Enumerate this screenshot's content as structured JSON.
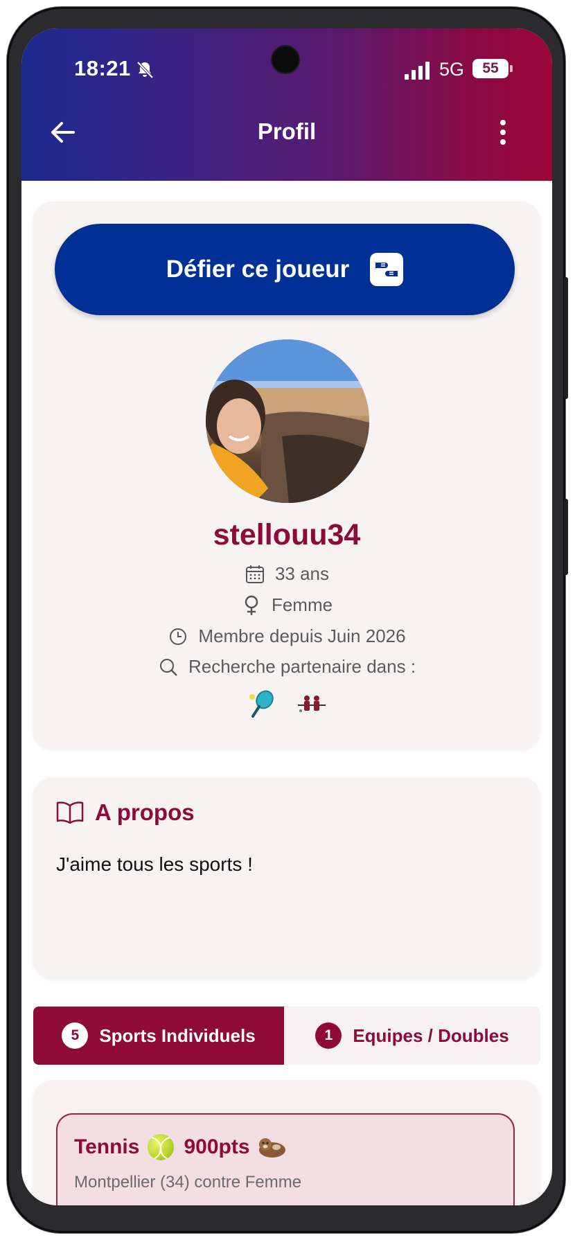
{
  "status_bar": {
    "time": "18:21",
    "network": "5G",
    "battery": "55"
  },
  "header": {
    "title": "Profil"
  },
  "profile": {
    "challenge_label": "Défier ce joueur",
    "username": "stellouu34",
    "age": "33 ans",
    "gender": "Femme",
    "member_since": "Membre depuis Juin 2026",
    "looking_for": "Recherche partenaire dans :",
    "sport_icons": [
      "padel-racket-icon",
      "table-football-icon"
    ]
  },
  "about": {
    "title": "A propos",
    "text": "J'aime tous les sports !"
  },
  "tabs": [
    {
      "count": "5",
      "label": "Sports Individuels",
      "active": true
    },
    {
      "count": "1",
      "label": "Equipes / Doubles",
      "active": false
    }
  ],
  "sports": [
    {
      "name": "Tennis",
      "points": "900pts",
      "details": "Montpellier (34) contre Femme"
    }
  ],
  "colors": {
    "brand": "#900a38",
    "button": "#003096",
    "gradient_start": "#1c2a8f",
    "gradient_end": "#9a0637"
  }
}
